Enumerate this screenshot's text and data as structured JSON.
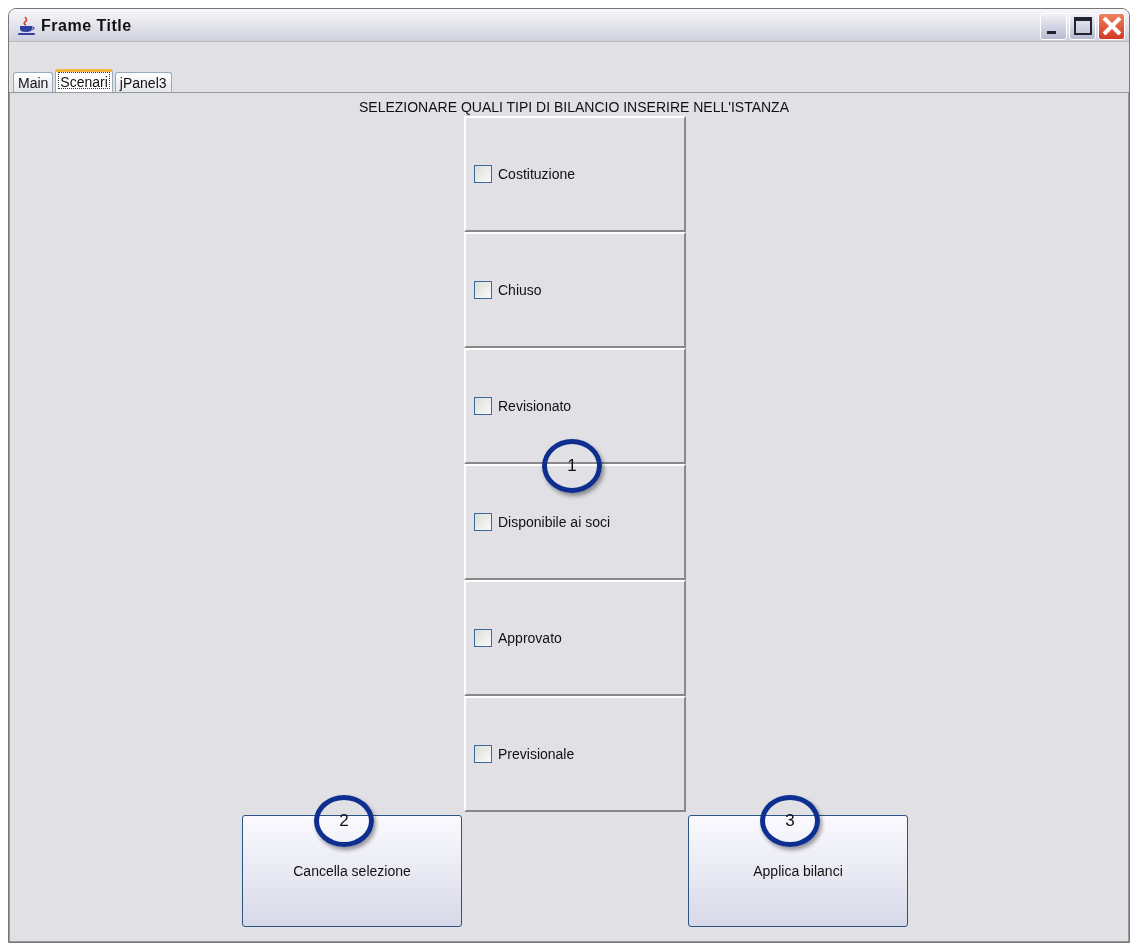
{
  "window": {
    "title": "Frame Title"
  },
  "tabs": [
    {
      "label": "Main",
      "selected": false
    },
    {
      "label": "Scenari",
      "selected": true
    },
    {
      "label": "jPanel3",
      "selected": false
    }
  ],
  "heading": "SELEZIONARE QUALI TIPI DI BILANCIO INSERIRE NELL'ISTANZA",
  "options": [
    {
      "label": "Costituzione",
      "checked": false
    },
    {
      "label": "Chiuso",
      "checked": false
    },
    {
      "label": "Revisionato",
      "checked": false
    },
    {
      "label": "Disponibile ai soci",
      "checked": false
    },
    {
      "label": "Approvato",
      "checked": false
    },
    {
      "label": "Previsionale",
      "checked": false
    }
  ],
  "buttons": [
    {
      "label": "Cancella selezione",
      "callout": "2"
    },
    {
      "label": "Applica bilanci",
      "callout": "3"
    }
  ],
  "panel_callout": "1"
}
